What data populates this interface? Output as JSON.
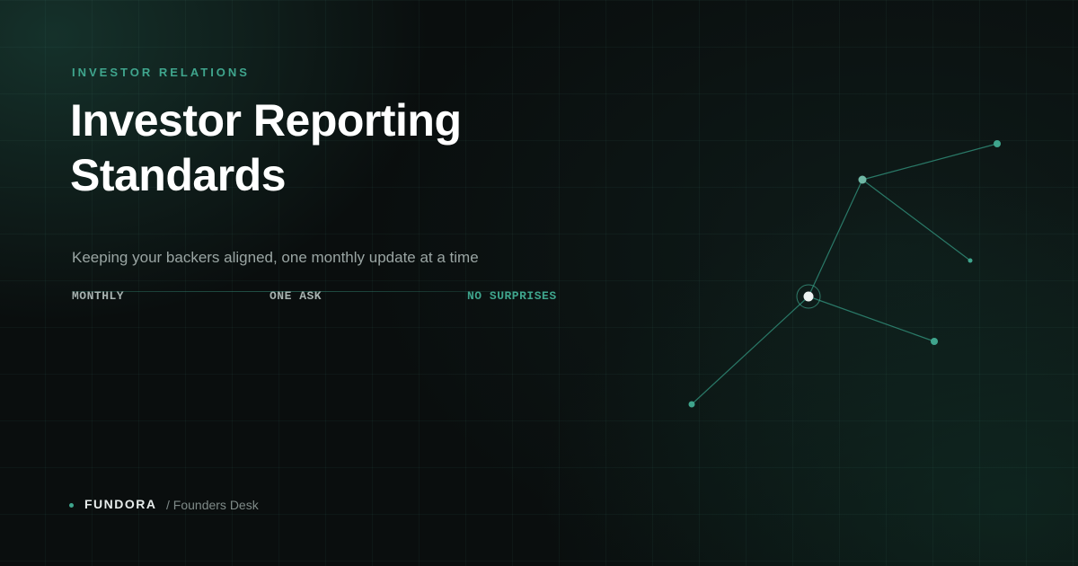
{
  "header": {
    "eyebrow": "INVESTOR RELATIONS",
    "title": "Investor Reporting Standards",
    "subtitle": "Keeping your backers aligned, one monthly update at a time"
  },
  "tags": [
    "MONTHLY",
    "ONE ASK",
    "NO SURPRISES"
  ],
  "footer": {
    "brand": "FUNDORA",
    "section": "/ Founders Desk"
  },
  "colors": {
    "accent": "#3fa58d",
    "background": "#0a0e0e",
    "title": "#ffffff",
    "muted": "#9aa5a3"
  }
}
